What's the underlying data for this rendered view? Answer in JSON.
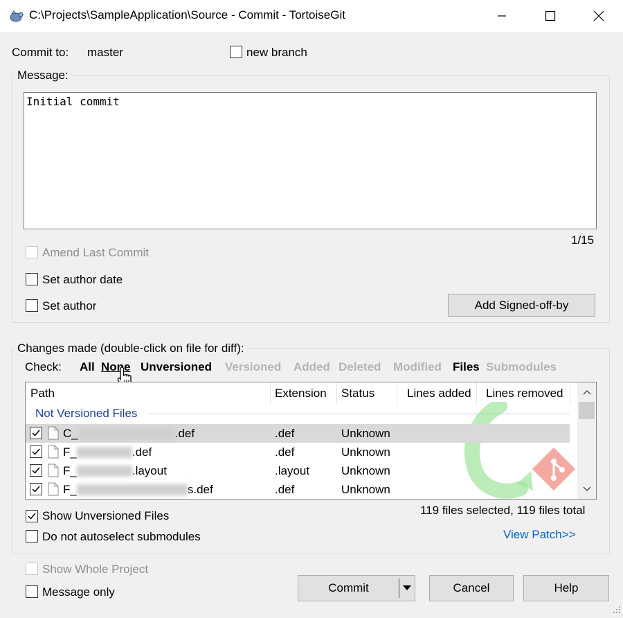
{
  "window": {
    "title": "C:\\Projects\\SampleApplication\\Source - Commit - TortoiseGit",
    "app_icon": "tortoisegit-icon",
    "minimize_icon": "minimize-icon",
    "maximize_icon": "maximize-icon",
    "close_icon": "close-icon"
  },
  "commit_to": {
    "label": "Commit to:",
    "branch": "master"
  },
  "new_branch": {
    "label": "new branch",
    "checked": false
  },
  "message": {
    "group_label": "Message:",
    "text": "Initial commit",
    "counter": "1/15"
  },
  "options": {
    "amend": {
      "label": "Amend Last Commit",
      "checked": false,
      "disabled": true
    },
    "author_date": {
      "label": "Set author date",
      "checked": false
    },
    "author": {
      "label": "Set author",
      "checked": false
    },
    "signed_off_button": "Add Signed-off-by"
  },
  "changes": {
    "group_label": "Changes made (double-click on file for diff):",
    "check_label": "Check:",
    "filters": [
      {
        "label": "All",
        "enabled": true
      },
      {
        "label": "None",
        "enabled": true
      },
      {
        "label": "Unversioned",
        "enabled": true
      },
      {
        "label": "Versioned",
        "enabled": false
      },
      {
        "label": "Added",
        "enabled": false
      },
      {
        "label": "Deleted",
        "enabled": false
      },
      {
        "label": "Modified",
        "enabled": false
      },
      {
        "label": "Files",
        "enabled": true
      },
      {
        "label": "Submodules",
        "enabled": false
      }
    ],
    "columns": [
      "Path",
      "Extension",
      "Status",
      "Lines added",
      "Lines removed"
    ],
    "group_row": "Not Versioned Files",
    "files": [
      {
        "path_prefix": "C_",
        "path_suffix": ".def",
        "extension": ".def",
        "status": "Unknown",
        "checked": true,
        "selected": true
      },
      {
        "path_prefix": "F_",
        "path_suffix": ".def",
        "extension": ".def",
        "status": "Unknown",
        "checked": true,
        "selected": false
      },
      {
        "path_prefix": "F_",
        "path_suffix": ".layout",
        "extension": ".layout",
        "status": "Unknown",
        "checked": true,
        "selected": false
      },
      {
        "path_prefix": "F_",
        "path_suffix": "s.def",
        "extension": ".def",
        "status": "Unknown",
        "checked": true,
        "selected": false
      }
    ],
    "summary": "119 files selected, 119 files total",
    "show_unversioned": {
      "label": "Show Unversioned Files",
      "checked": true
    },
    "no_autoselect": {
      "label": "Do not autoselect submodules",
      "checked": false
    },
    "view_patch": "View Patch>>"
  },
  "footer": {
    "show_whole_project": {
      "label": "Show Whole Project",
      "checked": false,
      "disabled": true
    },
    "message_only": {
      "label": "Message only",
      "checked": false
    },
    "commit_button": "Commit",
    "commit_dropdown_icon": "dropdown-arrow-icon",
    "cancel_button": "Cancel",
    "help_button": "Help"
  },
  "colors": {
    "accent_link": "#0066cc",
    "group_row_text": "#1e3f9e",
    "selected_row": "#d9d9d9",
    "disabled_text": "#8d8d8d"
  }
}
